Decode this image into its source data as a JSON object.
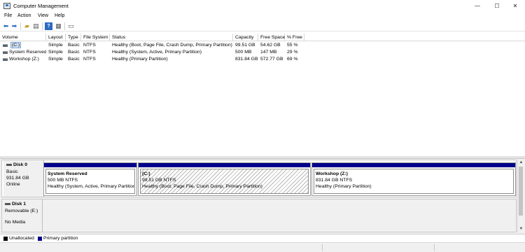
{
  "window": {
    "title": "Computer Management",
    "minimize": "—",
    "maximize": "☐",
    "close": "✕"
  },
  "menu": [
    "File",
    "Action",
    "View",
    "Help"
  ],
  "toolbar": {
    "back_icon": "back-arrow-icon",
    "forward_icon": "forward-arrow-icon",
    "up_icon": "up-folder-icon",
    "console_icon": "console-tree-icon",
    "help_icon": "help-icon",
    "properties_icon": "properties-icon"
  },
  "volumes": {
    "columns": [
      "Volume",
      "Layout",
      "Type",
      "File System",
      "Status",
      "Capacity",
      "Free Space",
      "% Free"
    ],
    "rows": [
      {
        "volume": "(C:)",
        "layout": "Simple",
        "type": "Basic",
        "fs": "NTFS",
        "status": "Healthy (Boot, Page File, Crash Dump, Primary Partition)",
        "capacity": "99.51 GB",
        "free": "54.62 GB",
        "pct": "55 %"
      },
      {
        "volume": "System Reserved",
        "layout": "Simple",
        "type": "Basic",
        "fs": "NTFS",
        "status": "Healthy (System, Active, Primary Partition)",
        "capacity": "500 MB",
        "free": "147 MB",
        "pct": "29 %"
      },
      {
        "volume": "Workshop (Z:)",
        "layout": "Simple",
        "type": "Basic",
        "fs": "NTFS",
        "status": "Healthy (Primary Partition)",
        "capacity": "831.84 GB",
        "free": "572.77 GB",
        "pct": "69 %"
      }
    ]
  },
  "disks": [
    {
      "name": "Disk 0",
      "kind": "Basic",
      "size": "931.84 GB",
      "state": "Online",
      "partitions": [
        {
          "name": "System Reserved",
          "size": "500 MB NTFS",
          "status": "Healthy (System, Active, Primary Partition"
        },
        {
          "name": "(C:)",
          "size": "99.51 GB NTFS",
          "status": "Healthy (Boot, Page File, Crash Dump, Primary Partition)"
        },
        {
          "name": "Workshop  (Z:)",
          "size": "831.84 GB NTFS",
          "status": "Healthy (Primary Partition)"
        }
      ]
    },
    {
      "name": "Disk 1",
      "kind": "Removable (E:)",
      "size": "",
      "state": "No Media"
    }
  ],
  "legend": [
    {
      "label": "Unallocated",
      "color": "#000000"
    },
    {
      "label": "Primary partition",
      "color": "#00008b"
    }
  ],
  "colors": {
    "partition_bar": "#00008b",
    "selection": "#d6e6f7"
  }
}
